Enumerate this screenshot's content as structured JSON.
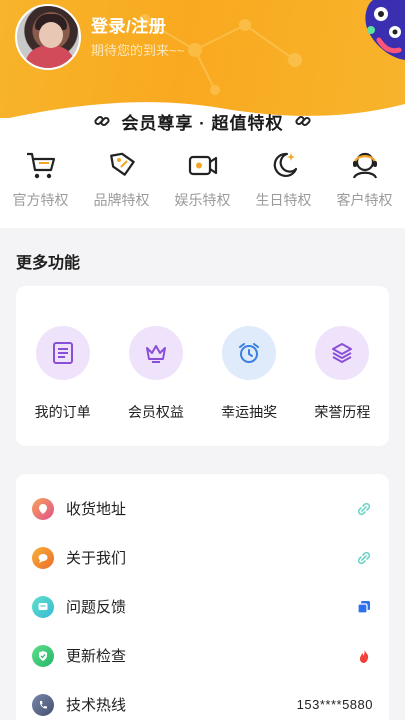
{
  "header": {
    "login_label": "登录/注册",
    "welcome_text": "期待您的到来~~"
  },
  "vip": {
    "title": "会员尊享 · 超值特权"
  },
  "privileges": [
    {
      "label": "官方特权",
      "icon": "cart-icon"
    },
    {
      "label": "品牌特权",
      "icon": "tag-icon"
    },
    {
      "label": "娱乐特权",
      "icon": "video-icon"
    },
    {
      "label": "生日特权",
      "icon": "moon-icon"
    },
    {
      "label": "客户特权",
      "icon": "headset-icon"
    }
  ],
  "more_functions": {
    "title": "更多功能",
    "items": [
      {
        "label": "我的订单",
        "icon": "order-list-icon"
      },
      {
        "label": "会员权益",
        "icon": "crown-icon"
      },
      {
        "label": "幸运抽奖",
        "icon": "alarm-clock-icon"
      },
      {
        "label": "荣誉历程",
        "icon": "layers-icon"
      }
    ]
  },
  "menu": [
    {
      "label": "收货地址",
      "icon": "address-icon",
      "trail_icon": "link-icon"
    },
    {
      "label": "关于我们",
      "icon": "chat-icon",
      "trail_icon": "link-icon"
    },
    {
      "label": "问题反馈",
      "icon": "feedback-icon",
      "trail_icon": "copy-icon"
    },
    {
      "label": "更新检查",
      "icon": "shield-check-icon",
      "trail_icon": "flame-icon"
    },
    {
      "label": "技术热线",
      "icon": "phone-icon",
      "value": "153****5880"
    }
  ],
  "colors": {
    "header": "#f9a91f",
    "accent_purple": "#8a4fd8",
    "teal": "#6fd3c6"
  }
}
